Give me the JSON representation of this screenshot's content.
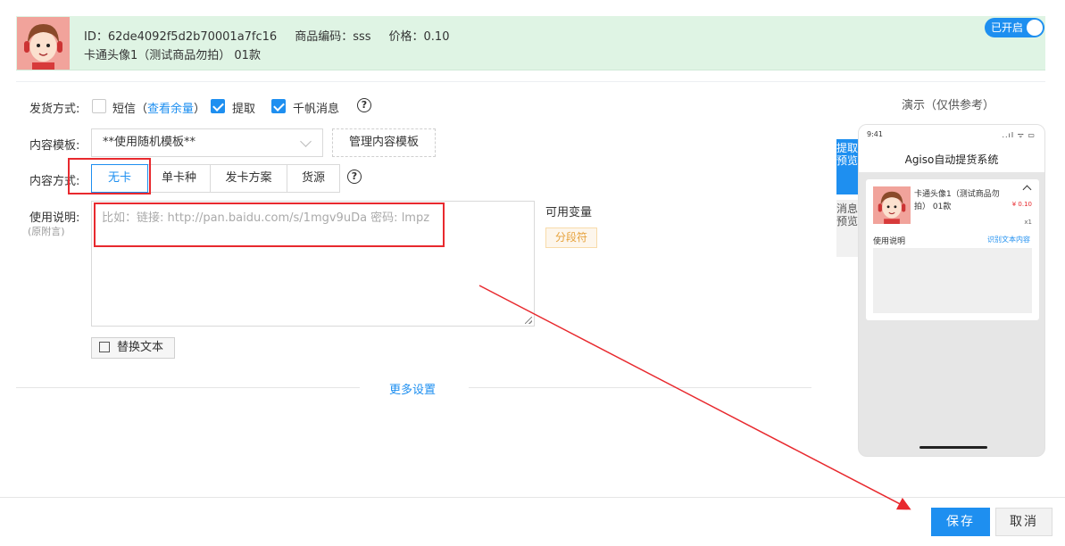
{
  "product": {
    "id_text": "ID：62de4092f5d2b70001a7fc16",
    "code_text": "商品编码：sss",
    "price_text": "价格：0.10",
    "name": "卡通头像1（测试商品勿拍） 01款",
    "toggle_label": "已开启"
  },
  "form": {
    "delivery_label": "发货方式:",
    "sms_label": "短信",
    "sms_open": "（",
    "check_balance": "查看余量",
    "sms_close": "）",
    "pickup_label": "提取",
    "qianfan_label": "千帆消息",
    "template_label": "内容模板:",
    "template_value": "**使用随机模板**",
    "manage_template": "管理内容模板",
    "content_method_label": "内容方式:",
    "methods": [
      "无卡",
      "单卡种",
      "发卡方案",
      "货源"
    ],
    "usage_label": "使用说明:",
    "usage_sub": "(原附言)",
    "usage_placeholder": "比如：链接: http://pan.baidu.com/s/1mgv9uDa 密码: lmpz",
    "vars_title": "可用变量",
    "var_tag": "分段符",
    "replace_text": "替换文本",
    "more_settings": "更多设置",
    "help_icon": "?"
  },
  "preview": {
    "title": "演示（仅供参考）",
    "time": "9:41",
    "status_icons": "..ıl ᯤ ▭",
    "app_title": "Agiso自动提货系统",
    "item_name": "卡通头像1（测试商品勿拍） 01款",
    "item_price": "¥ 0.10",
    "item_qty": "x1",
    "usage_label": "使用说明",
    "copy_label": "识别文本内容",
    "tab_pickup": "提取预览",
    "tab_message": "消息预览"
  },
  "footer": {
    "save": "保存",
    "cancel": "取消"
  },
  "colors": {
    "accent": "#1e8ff0",
    "header_bg": "#dff4e4",
    "annotation_red": "#e8292e"
  }
}
